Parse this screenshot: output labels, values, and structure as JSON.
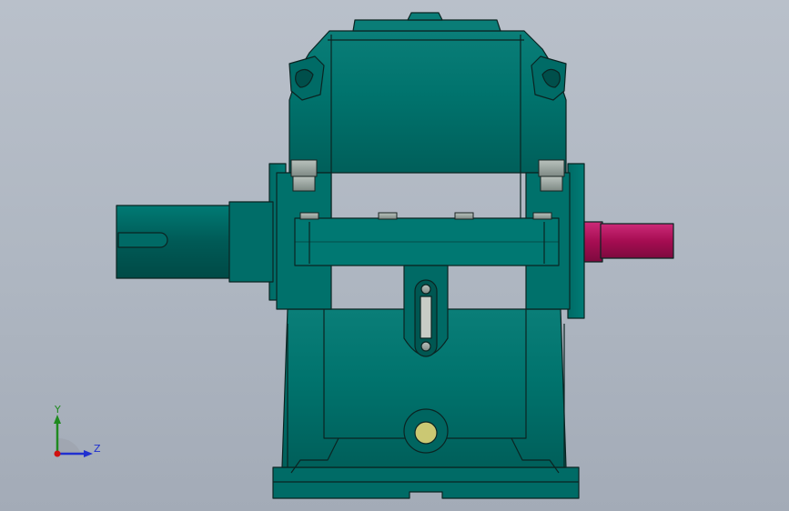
{
  "viewport": {
    "background": "#b3bac5",
    "model_color": "#007a74",
    "model_edge_color": "#0b2422",
    "output_shaft_color": "#b0125a",
    "oil_sight_glass_color": "#c9c46a",
    "fastener_color": "#9aa39d"
  },
  "triad": {
    "y_label": "Y",
    "z_label": "Z",
    "y_color": "#1f8a1f",
    "z_color": "#2030d0",
    "origin_color": "#d01010"
  }
}
